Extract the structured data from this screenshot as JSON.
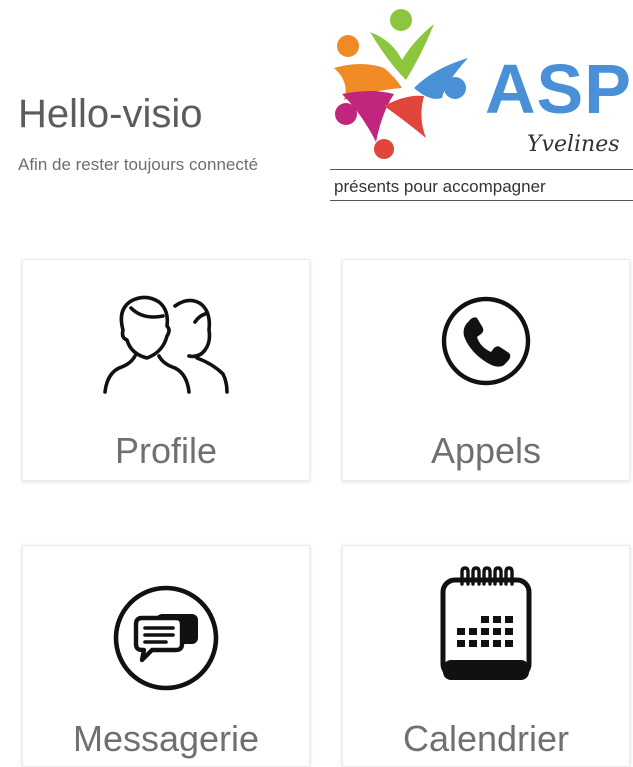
{
  "header": {
    "title": "Hello-visio",
    "subtitle": "Afin de rester toujours connecté"
  },
  "logo": {
    "name": "ASP",
    "region": "Yvelines",
    "tagline": "présents pour accompagner",
    "colors": {
      "green": "#8cc63e",
      "orange": "#f08a24",
      "red": "#e0463c",
      "magenta": "#c2257d",
      "blue": "#4a90d6"
    }
  },
  "tiles": [
    {
      "label": "Profile",
      "icon": "people-icon"
    },
    {
      "label": "Appels",
      "icon": "phone-icon"
    },
    {
      "label": "Messagerie",
      "icon": "chat-icon"
    },
    {
      "label": "Calendrier",
      "icon": "calendar-icon"
    }
  ],
  "colors": {
    "text_primary": "#5c5c5c",
    "icon_stroke": "#111111"
  }
}
